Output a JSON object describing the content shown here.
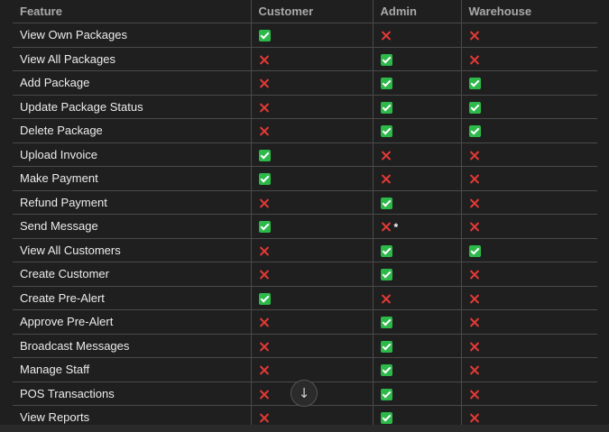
{
  "table": {
    "headers": [
      "Feature",
      "Customer",
      "Admin",
      "Warehouse"
    ],
    "rows": [
      {
        "feature": "View Own Packages",
        "cells": [
          "yes",
          "no",
          "no"
        ]
      },
      {
        "feature": "View All Packages",
        "cells": [
          "no",
          "yes",
          "no"
        ]
      },
      {
        "feature": "Add Package",
        "cells": [
          "no",
          "yes",
          "yes"
        ]
      },
      {
        "feature": "Update Package Status",
        "cells": [
          "no",
          "yes",
          "yes"
        ]
      },
      {
        "feature": "Delete Package",
        "cells": [
          "no",
          "yes",
          "yes"
        ]
      },
      {
        "feature": "Upload Invoice",
        "cells": [
          "yes",
          "no",
          "no"
        ]
      },
      {
        "feature": "Make Payment",
        "cells": [
          "yes",
          "no",
          "no"
        ]
      },
      {
        "feature": "Refund Payment",
        "cells": [
          "no",
          "yes",
          "no"
        ]
      },
      {
        "feature": "Send Message",
        "cells": [
          "yes",
          "no*",
          "no"
        ]
      },
      {
        "feature": "View All Customers",
        "cells": [
          "no",
          "yes",
          "yes"
        ]
      },
      {
        "feature": "Create Customer",
        "cells": [
          "no",
          "yes",
          "no"
        ]
      },
      {
        "feature": "Create Pre-Alert",
        "cells": [
          "yes",
          "no",
          "no"
        ]
      },
      {
        "feature": "Approve Pre-Alert",
        "cells": [
          "no",
          "yes",
          "no"
        ]
      },
      {
        "feature": "Broadcast Messages",
        "cells": [
          "no",
          "yes",
          "no"
        ]
      },
      {
        "feature": "Manage Staff",
        "cells": [
          "no",
          "yes",
          "no"
        ]
      },
      {
        "feature": "POS Transactions",
        "cells": [
          "no",
          "yes",
          "no"
        ]
      },
      {
        "feature": "View Reports",
        "cells": [
          "no",
          "yes",
          "no"
        ]
      }
    ],
    "footnote_marker": "*"
  },
  "icons": {
    "yes": "green-check-icon",
    "no": "red-cross-icon",
    "scroll": "arrow-down-icon"
  },
  "scroll_button": {
    "glyph": "↓"
  },
  "colors": {
    "background": "#1f1f1f",
    "border": "#4a4a4a",
    "header_text": "#a9a9a9",
    "check": "#2db84a",
    "cross": "#e53935"
  }
}
